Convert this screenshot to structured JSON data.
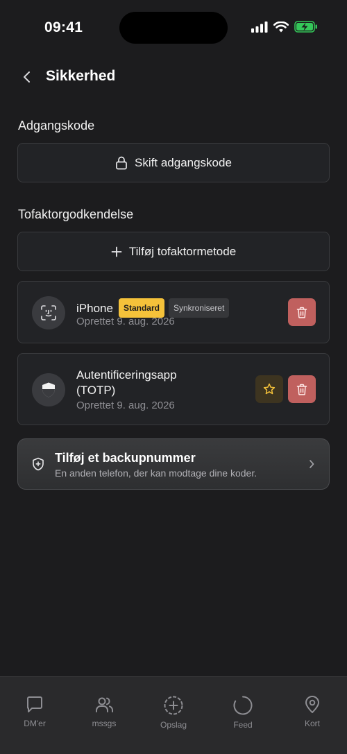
{
  "status_bar": {
    "time": "09:41"
  },
  "header": {
    "title": "Sikkerhed"
  },
  "password_section": {
    "title": "Adgangskode",
    "change_button": "Skift adgangskode"
  },
  "twofa_section": {
    "title": "Tofaktorgodkendelse",
    "add_button": "Tilføj tofaktormetode",
    "methods": [
      {
        "name": "iPhone",
        "badges": [
          "Standard",
          "Synkroniseret"
        ],
        "created": "Oprettet 9. aug. 2026",
        "icon": "face-id-icon"
      },
      {
        "name_line1": "Autentificeringsapp",
        "name_line2": "(TOTP)",
        "created": "Oprettet 9. aug. 2026",
        "icon": "shield-icon"
      }
    ]
  },
  "backup": {
    "title": "Tilføj et backupnummer",
    "subtitle": "En anden telefon, der kan modtage dine koder."
  },
  "tab_bar": {
    "tabs": [
      {
        "label": "DM'er",
        "icon": "chat-bubble-icon"
      },
      {
        "label": "mssgs",
        "icon": "users-icon"
      },
      {
        "label": "Opslag",
        "icon": "plus-circle-icon"
      },
      {
        "label": "Feed",
        "icon": "circle-icon"
      },
      {
        "label": "Kort",
        "icon": "map-pin-icon"
      }
    ]
  },
  "colors": {
    "background": "#1c1c1e",
    "card": "#222326",
    "standard_badge": "#f5c23a",
    "delete": "#c0605e",
    "battery": "#34c759"
  }
}
